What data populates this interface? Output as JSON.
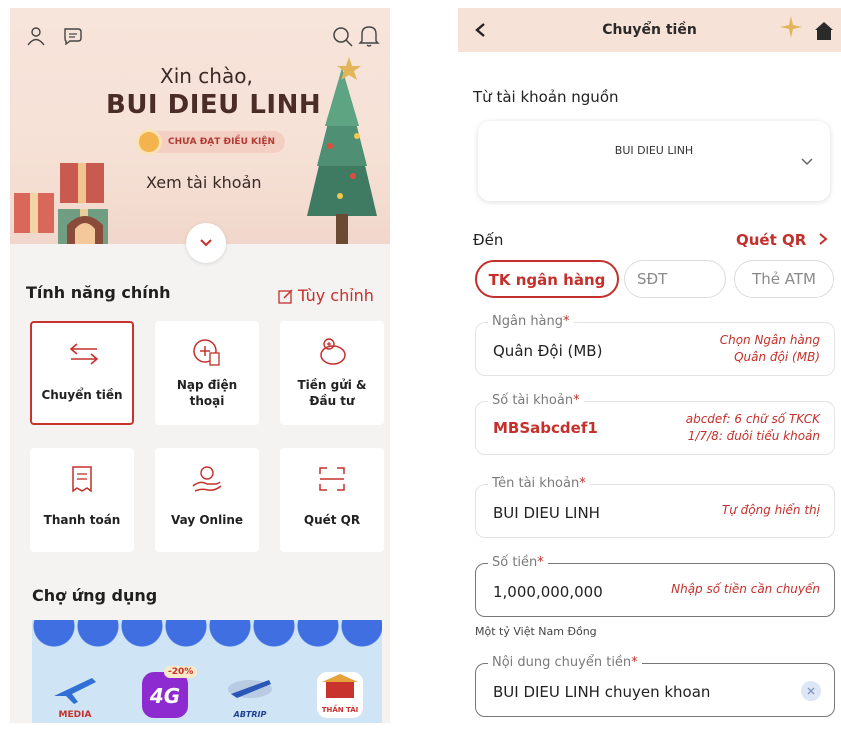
{
  "home": {
    "greeting": "Xin chào,",
    "user_name": "BUI DIEU LINH",
    "status_badge": "CHƯA ĐẠT ĐIỀU KIỆN",
    "view_account": "Xem tài khoản",
    "main_features_title": "Tính năng chính",
    "customize_label": "Tùy chỉnh",
    "features": [
      {
        "label": "Chuyển tiền"
      },
      {
        "label": "Nạp điện thoại"
      },
      {
        "label": "Tiền gửi & Đầu tư"
      },
      {
        "label": "Thanh toán"
      },
      {
        "label": "Vay Online"
      },
      {
        "label": "Quét QR"
      }
    ],
    "marketplace_title": "Chợ ứng dụng",
    "apps": [
      {
        "label": "MEDIA"
      },
      {
        "label": "4G",
        "badge": "-20%"
      },
      {
        "label": "ABTRIP"
      },
      {
        "label": "THẦN TÀI"
      }
    ]
  },
  "transfer": {
    "title": "Chuyển tiền",
    "source_label": "Từ tài khoản nguồn",
    "source_account_name": "BUI DIEU LINH",
    "to_label": "Đến",
    "scan_qr": "Quét QR",
    "tabs": [
      "TK ngân hàng",
      "SĐT",
      "Thẻ ATM"
    ],
    "fields": {
      "bank": {
        "label": "Ngân hàng",
        "value": "Quân Đội (MB)",
        "note_1": "Chọn Ngân hàng",
        "note_2": "Quân đội (MB)"
      },
      "account_number": {
        "label": "Số tài khoản",
        "value": "MBSabcdef1",
        "note_1": "abcdef: 6 chữ số TKCK",
        "note_2": "1/7/8: đuôi tiểu khoản"
      },
      "account_name": {
        "label": "Tên tài khoản",
        "value": "BUI DIEU LINH",
        "note_1": "Tự động hiển thị"
      },
      "amount": {
        "label": "Số tiền",
        "value": "1,000,000,000",
        "note_1": "Nhập số tiền cần chuyển",
        "in_words": "Một tỷ Việt Nam Đồng"
      },
      "content": {
        "label": "Nội dung chuyển tiền",
        "value": "BUI DIEU LINH chuyen khoan"
      }
    },
    "required_mark": "*"
  },
  "colors": {
    "accent": "#c4302b",
    "hero_bg": "#f6e1d6",
    "app_bg": "#f4f3f2"
  }
}
